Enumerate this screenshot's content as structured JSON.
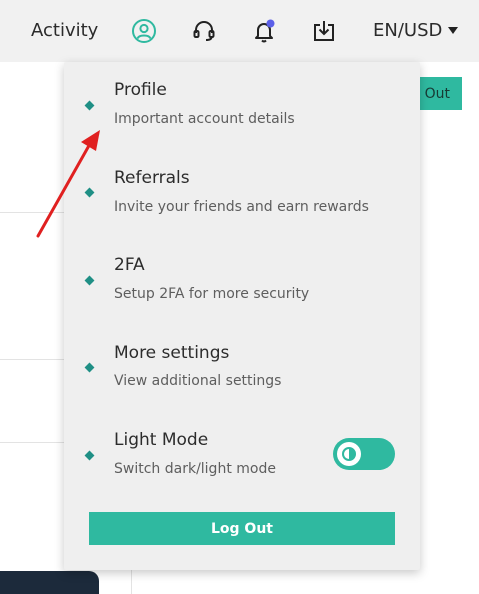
{
  "nav": {
    "activity_label": "Activity",
    "icons": [
      "user-circle-icon",
      "headset-icon",
      "bell-icon",
      "download-icon"
    ],
    "notification_dot_color": "#5b5fe8",
    "language_currency": "EN/USD"
  },
  "background": {
    "logout_label": "Out"
  },
  "menu": {
    "items": [
      {
        "title": "Profile",
        "description": "Important account details"
      },
      {
        "title": "Referrals",
        "description": "Invite your friends and earn rewards"
      },
      {
        "title": "2FA",
        "description": "Setup 2FA for more security"
      },
      {
        "title": "More settings",
        "description": "View additional settings"
      },
      {
        "title": "Light Mode",
        "description": "Switch dark/light mode"
      }
    ],
    "light_mode_toggle_on": true,
    "logout_label": "Log Out"
  },
  "colors": {
    "accent": "#2fb9a0",
    "bullet": "#1f8f85",
    "annotation_arrow": "#e02020"
  }
}
